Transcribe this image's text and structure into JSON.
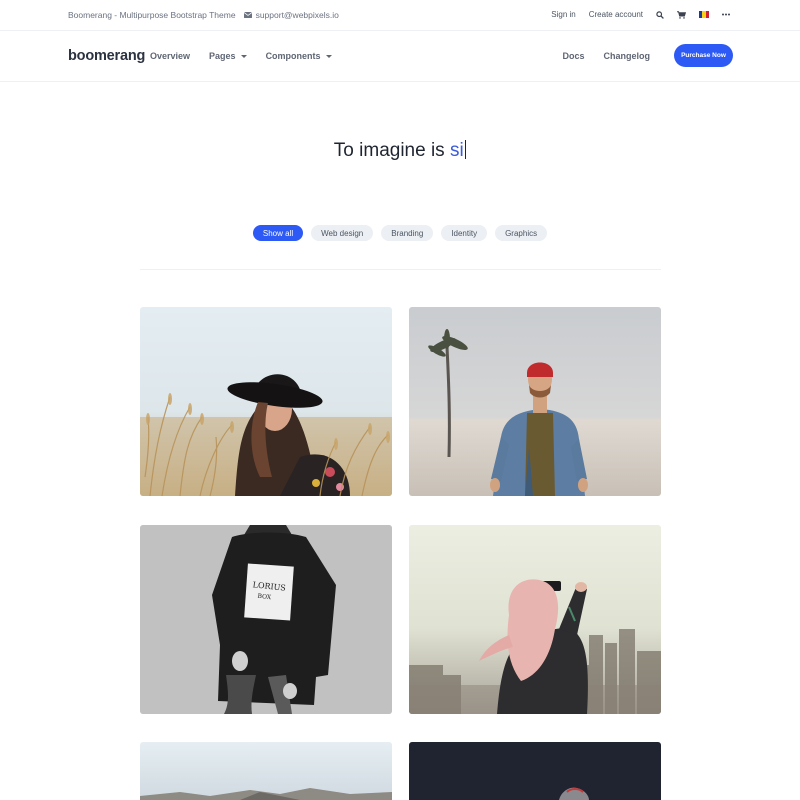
{
  "topbar": {
    "site_title": "Boomerang - Multipurpose Bootstrap Theme",
    "email": "support@webpixels.io",
    "sign_in": "Sign in",
    "create_account": "Create account",
    "icons": [
      "mail-icon",
      "search-icon",
      "cart-icon",
      "flag-icon",
      "more-icon"
    ]
  },
  "navbar": {
    "logo": "boomerang",
    "items": [
      {
        "label": "Overview"
      },
      {
        "label": "Pages"
      },
      {
        "label": "Components"
      }
    ],
    "right_items": [
      {
        "label": "Docs"
      },
      {
        "label": "Changelog"
      }
    ],
    "purchase_label": "Purchase Now"
  },
  "hero": {
    "prefix": "To imagine is ",
    "typed": "si"
  },
  "filters": [
    {
      "label": "Show all",
      "active": true
    },
    {
      "label": "Web design",
      "active": false
    },
    {
      "label": "Branding",
      "active": false
    },
    {
      "label": "Identity",
      "active": false
    },
    {
      "label": "Graphics",
      "active": false
    }
  ],
  "gallery": [
    {
      "subject": "woman-in-hat-field-photo"
    },
    {
      "subject": "man-denim-jacket-beach-photo"
    },
    {
      "subject": "black-sweatshirt-bw-photo"
    },
    {
      "subject": "pink-hair-woman-camera-photo"
    },
    {
      "subject": "mountain-landscape-photo"
    },
    {
      "subject": "dark-night-photo"
    }
  ],
  "colors": {
    "accent": "#2d59f5",
    "typed_text": "#3b5bdb",
    "pill_bg": "#eceff3"
  }
}
